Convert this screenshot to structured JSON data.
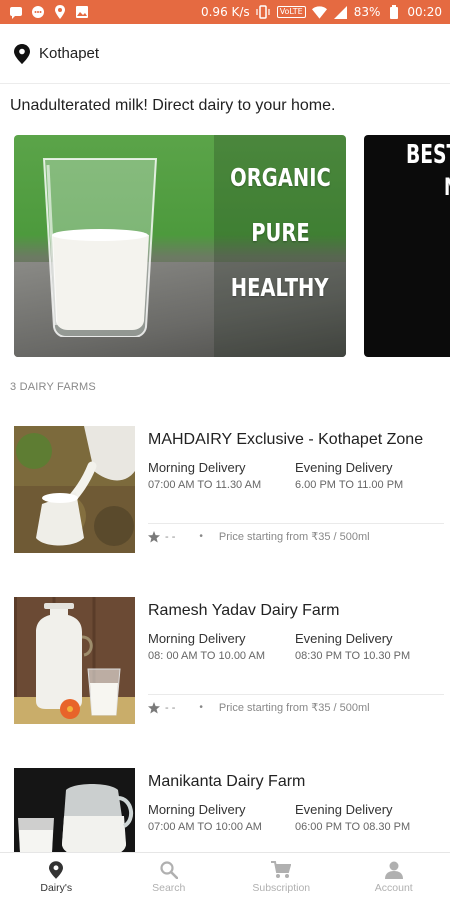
{
  "status_bar": {
    "speed": "0.96 K/s",
    "volte": "VoLTE",
    "battery": "83%",
    "time": "00:20",
    "icons": [
      "message-icon",
      "chat-icon",
      "location-icon",
      "image-icon",
      "vibrate-icon",
      "wifi-icon",
      "signal-icon",
      "battery-icon"
    ]
  },
  "location": {
    "name": "Kothapet",
    "icon": "location-pin-icon"
  },
  "tagline": "Unadulterated milk! Direct dairy to your home.",
  "banners": [
    {
      "words": [
        "ORGANIC",
        "PURE",
        "HEALTHY"
      ]
    },
    {
      "words": [
        "BEST",
        "N"
      ]
    }
  ],
  "farm_count": "3 DAIRY FARMS",
  "farms": [
    {
      "name": "MAHDAIRY Exclusive - Kothapet Zone",
      "morning_label": "Morning Delivery",
      "morning_time": "07:00 AM TO 11.30 AM",
      "evening_label": "Evening Delivery",
      "evening_time": "6.00 PM TO 11.00 PM",
      "rating": "- -",
      "price": "Price starting from  ₹35 / 500ml"
    },
    {
      "name": "Ramesh Yadav Dairy Farm",
      "morning_label": "Morning Delivery",
      "morning_time": "08: 00 AM TO 10.00 AM",
      "evening_label": "Evening Delivery",
      "evening_time": "08:30 PM TO 10.30 PM",
      "rating": "- -",
      "price": "Price starting from  ₹35 / 500ml"
    },
    {
      "name": "Manikanta Dairy Farm",
      "morning_label": "Morning Delivery",
      "morning_time": "07:00 AM TO 10:00 AM",
      "evening_label": "Evening Delivery",
      "evening_time": "06:00 PM TO 08.30 PM"
    }
  ],
  "nav": [
    {
      "label": "Dairy's",
      "icon": "location-pin-icon",
      "active": true
    },
    {
      "label": "Search",
      "icon": "search-icon",
      "active": false
    },
    {
      "label": "Subscription",
      "icon": "cart-icon",
      "active": false
    },
    {
      "label": "Account",
      "icon": "person-icon",
      "active": false
    }
  ],
  "colors": {
    "status_bar": "#e56a41",
    "nav_active": "#333333",
    "nav_inactive": "#b0b0b0"
  }
}
